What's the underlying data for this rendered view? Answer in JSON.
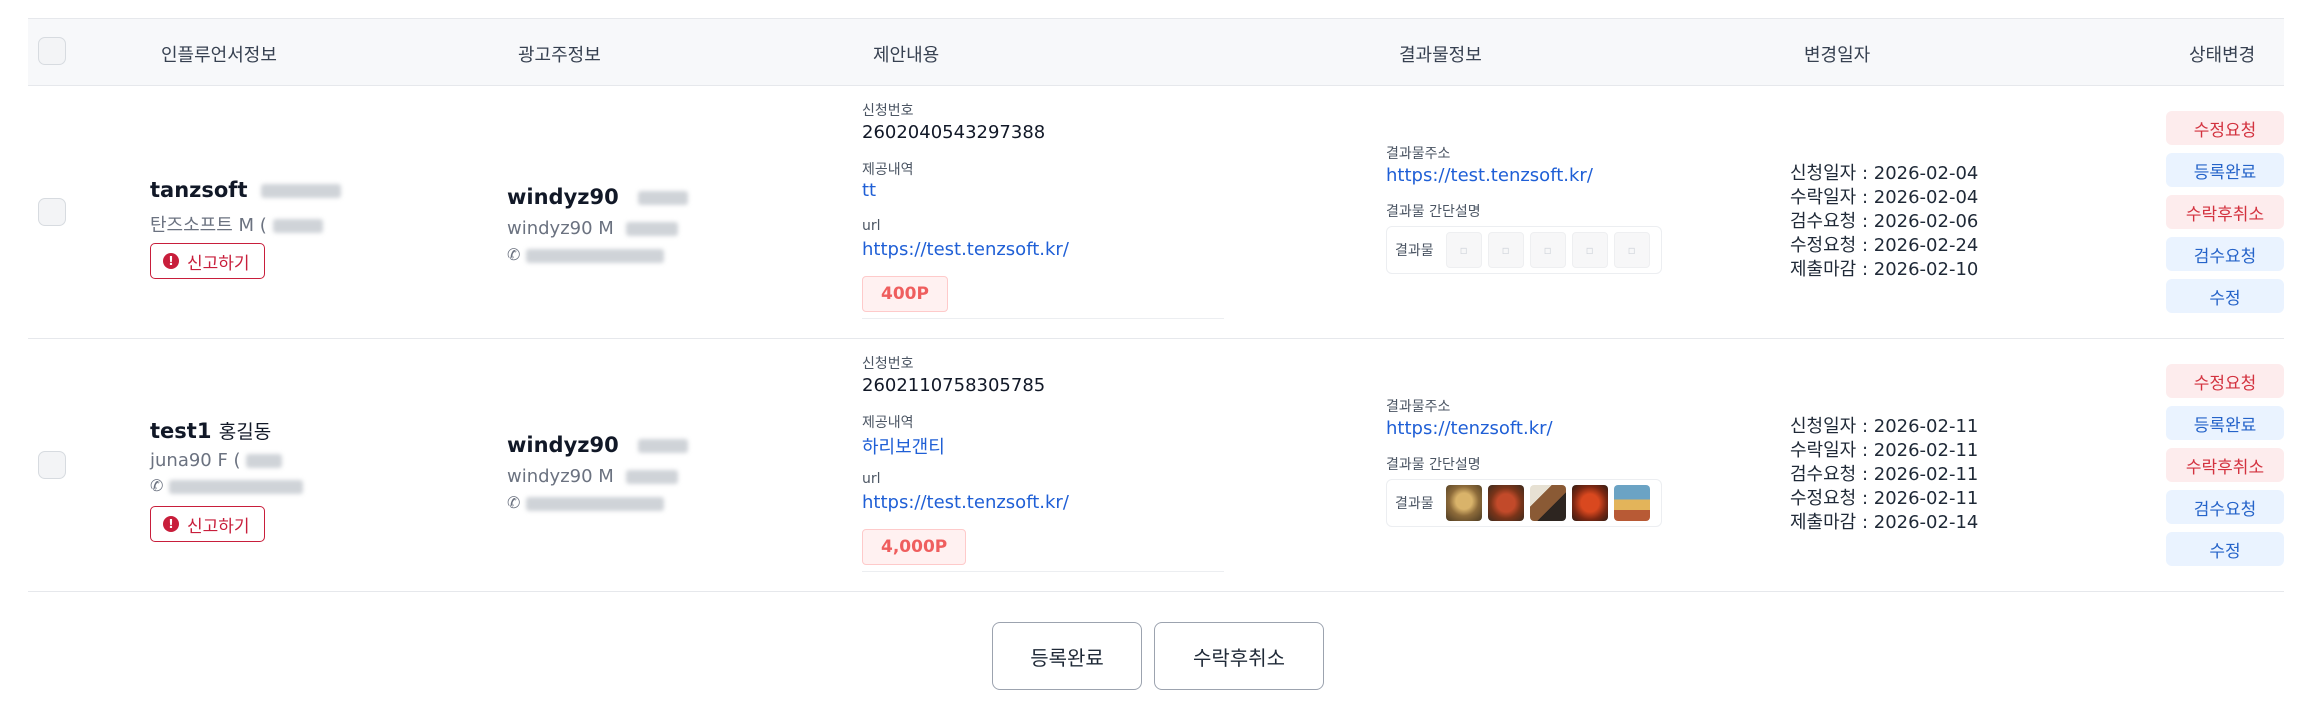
{
  "header": {
    "influencer": "인플루언서정보",
    "advertiser": "광고주정보",
    "proposal": "제안내용",
    "result": "결과물정보",
    "changed_date": "변경일자",
    "status": "상태변경"
  },
  "labels": {
    "apply_no": "신청번호",
    "offer": "제공내역",
    "url": "url",
    "result_url": "결과물주소",
    "result_desc": "결과물 간단설명",
    "result": "결과물",
    "report": "신고하기"
  },
  "rows": [
    {
      "influencer": {
        "id": "tanzsoft",
        "name": "",
        "meta": "탄즈소프트 M ("
      },
      "advertiser": {
        "id": "windyz90",
        "meta": "windyz90 M"
      },
      "apply_no": "2602040543297388",
      "offer": "tt",
      "url": "https://test.tenzsoft.kr/",
      "points": "400P",
      "result_url": "https://test.tenzsoft.kr/",
      "result_thumbs": [],
      "dates": [
        "신청일자 : 2026-02-04",
        "수락일자 : 2026-02-04",
        "검수요청 : 2026-02-06",
        "수정요청 : 2026-02-24",
        "제출마감 : 2026-02-10"
      ]
    },
    {
      "influencer": {
        "id": "test1",
        "name": "홍길동",
        "meta": "juna90 F ("
      },
      "advertiser": {
        "id": "windyz90",
        "meta": "windyz90 M"
      },
      "apply_no": "2602110758305785",
      "offer": "하리보갠티",
      "url": "https://test.tenzsoft.kr/",
      "points": "4,000P",
      "result_url": "https://tenzsoft.kr/",
      "result_thumbs": [
        "food-photo-1",
        "food-photo-2",
        "food-photo-3",
        "food-photo-4",
        "food-photo-5"
      ],
      "dates": [
        "신청일자 : 2026-02-11",
        "수락일자 : 2026-02-11",
        "검수요청 : 2026-02-11",
        "수정요청 : 2026-02-11",
        "제출마감 : 2026-02-14"
      ]
    }
  ],
  "status_buttons": [
    "수정요청",
    "등록완료",
    "수락후취소",
    "검수요청",
    "수정"
  ],
  "bulk": {
    "register_done": "등록완료",
    "cancel_after_accept": "수락후취소"
  },
  "colors": {
    "link": "#1f5fd6",
    "danger": "#c81e3b",
    "point": "#ef5e5e"
  }
}
